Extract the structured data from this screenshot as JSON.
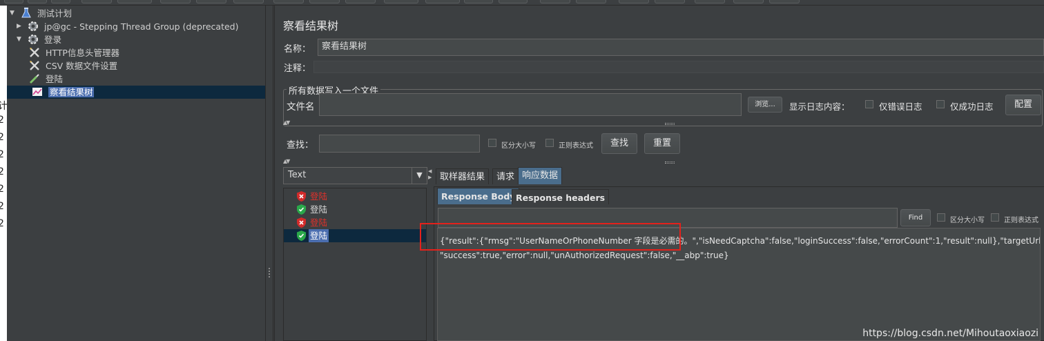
{
  "tree": {
    "items": [
      {
        "label": "测试计划",
        "icon": "flask-icon"
      },
      {
        "label": "jp@gc - Stepping Thread Group (deprecated)",
        "icon": "gear-icon"
      },
      {
        "label": "登录",
        "icon": "gear-icon"
      },
      {
        "label": "HTTP信息头管理器",
        "icon": "tools-icon"
      },
      {
        "label": "CSV 数据文件设置",
        "icon": "tools-icon"
      },
      {
        "label": "登陆",
        "icon": "pipette-icon"
      },
      {
        "label": "察看结果树",
        "icon": "chart-icon"
      }
    ]
  },
  "left_edge_fragments": [
    "计",
    "2",
    "2",
    "2",
    "2",
    "2",
    "2",
    "2"
  ],
  "listener": {
    "title": "察看结果树",
    "name_label": "名称：",
    "name_value": "察看结果树",
    "comment_label": "注释：",
    "fieldset_legend": "所有数据写入一个文件",
    "filename_label": "文件名",
    "browse_label": "浏览...",
    "log_content_label": "显示日志内容：",
    "errors_only_label": "仅错误日志",
    "success_only_label": "仅成功日志",
    "configure_label": "配置"
  },
  "search": {
    "label": "查找：",
    "case_label": "区分大小写",
    "regex_label": "正则表达式",
    "find_label": "查找",
    "reset_label": "重置"
  },
  "renderer": {
    "selected": "Text"
  },
  "results": [
    {
      "label": "登陆",
      "status": "fail"
    },
    {
      "label": "登陆",
      "status": "ok"
    },
    {
      "label": "登陆",
      "status": "fail"
    },
    {
      "label": "登陆",
      "status": "ok"
    }
  ],
  "tabs": {
    "sampler_result": "取样器结果",
    "request": "请求",
    "response_data": "响应数据"
  },
  "subtabs": {
    "response_body": "Response Body",
    "response_headers": "Response headers"
  },
  "response_search": {
    "find_label": "Find",
    "case_label": "区分大小写",
    "regex_label": "正则表达式"
  },
  "response_body": {
    "line1": "{\"result\":{\"rmsg\":\"UserNameOrPhoneNumber 字段是必需的。\",\"isNeedCaptcha\":false,\"loginSuccess\":false,\"errorCount\":1,\"result\":null},\"targetUrl\":null,",
    "line2": "\"success\":true,\"error\":null,\"unAuthorizedRequest\":false,\"__abp\":true}"
  },
  "watermark": "https://blog.csdn.net/Mihoutaoxiaozi",
  "colors": {
    "background": "#3c3f41",
    "selection": "#4b6eaf",
    "fail": "#e0312b",
    "highlight_box": "#e5211b"
  }
}
